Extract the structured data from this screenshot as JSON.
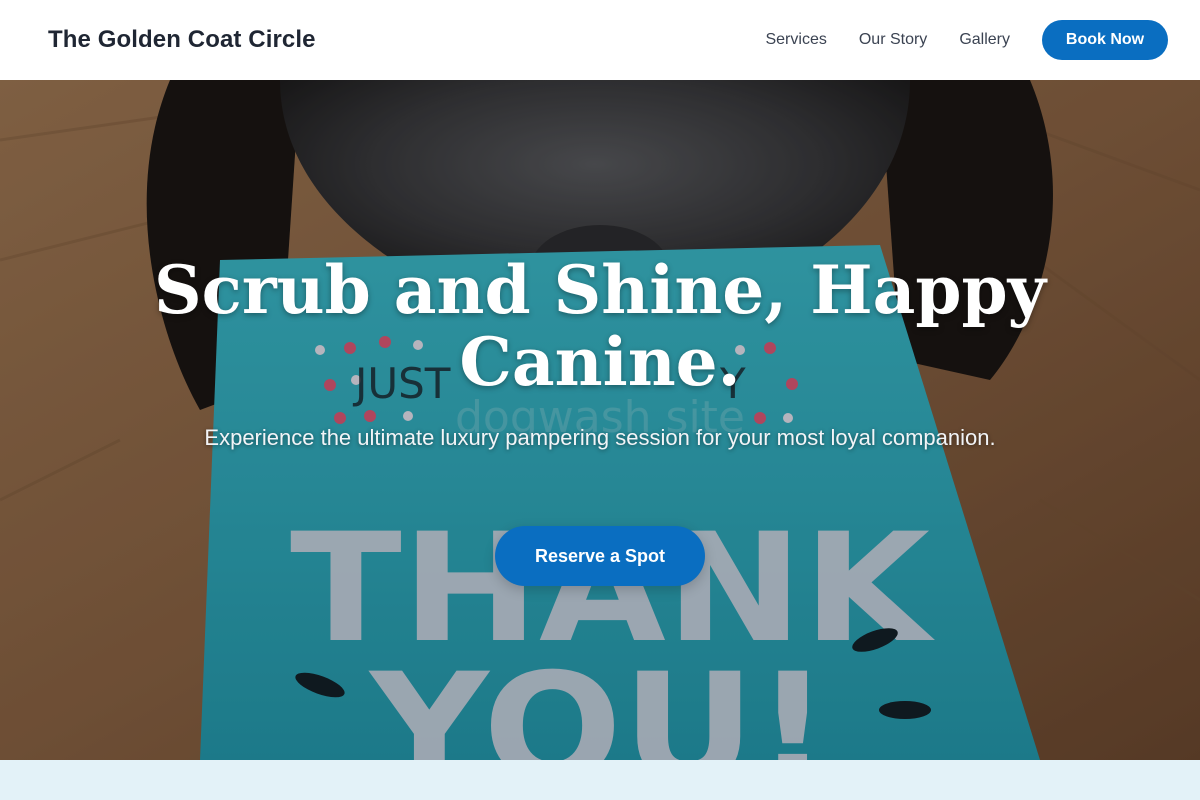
{
  "header": {
    "brand": "The Golden Coat Circle",
    "nav": [
      {
        "label": "Services"
      },
      {
        "label": "Our Story"
      },
      {
        "label": "Gallery"
      }
    ],
    "cta_label": "Book Now"
  },
  "hero": {
    "title": "Scrub and Shine, Happy Canine.",
    "subtitle": "Experience the ultimate luxury pampering session for your most loyal companion.",
    "cta_label": "Reserve a Spot",
    "photo": {
      "card_text_top": "JUST",
      "card_text_right": "Y",
      "card_text_main": "THANK",
      "card_text_bottom": "YOU!",
      "watermark": "dogwash site"
    }
  },
  "colors": {
    "accent": "#0a6ec1",
    "brand_text": "#1f2633",
    "next_section_bg": "#e3f2f8",
    "card": "#2fb3c4"
  }
}
